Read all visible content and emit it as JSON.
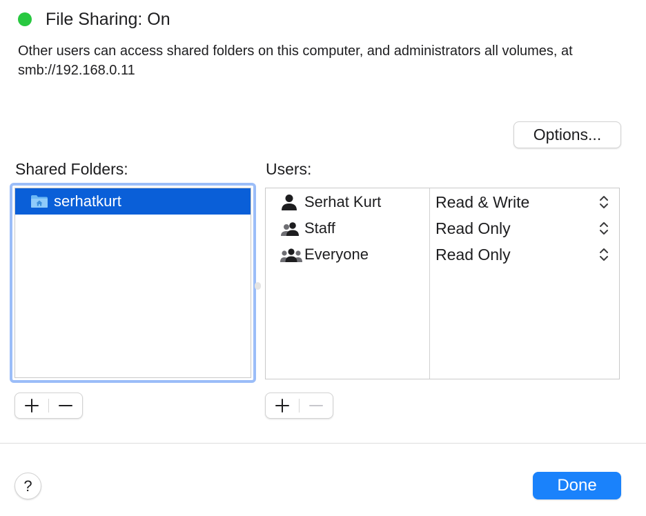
{
  "status": {
    "indicator_color": "#28c840",
    "title": "File Sharing: On",
    "description": "Other users can access shared folders on this computer, and administrators all volumes, at smb://192.168.0.11"
  },
  "options_button": {
    "label": "Options..."
  },
  "shared_folders": {
    "label": "Shared Folders:",
    "items": [
      {
        "name": "serhatkurt",
        "icon": "home-folder-icon",
        "selected": true
      }
    ]
  },
  "users": {
    "label": "Users:",
    "rows": [
      {
        "name": "Serhat Kurt",
        "icon": "single-user-icon",
        "permission": "Read & Write"
      },
      {
        "name": "Staff",
        "icon": "group-icon",
        "permission": "Read Only"
      },
      {
        "name": "Everyone",
        "icon": "everyone-icon",
        "permission": "Read Only"
      }
    ]
  },
  "controls": {
    "add_symbol": "+",
    "remove_symbol": "−",
    "users_remove_enabled": false
  },
  "footer": {
    "help_label": "?",
    "done_label": "Done"
  },
  "colors": {
    "selection": "#0a5fd8",
    "focus_ring": "#9bbdf8",
    "primary_button": "#1a82fb"
  }
}
